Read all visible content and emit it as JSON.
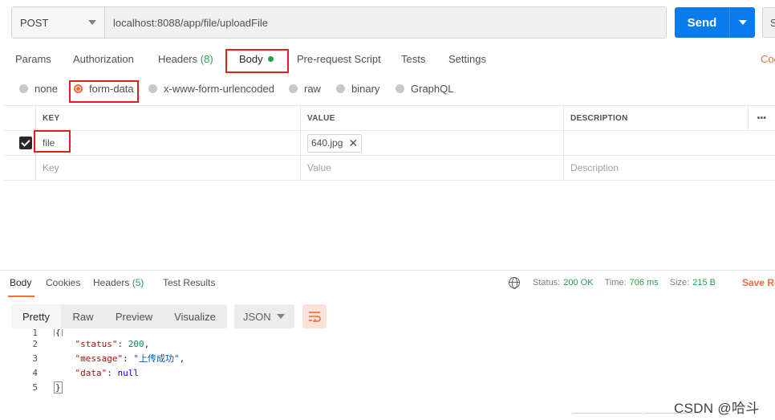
{
  "request": {
    "method": "POST",
    "url": "localhost:8088/app/file/uploadFile",
    "send_label": "Send",
    "save_label": "S"
  },
  "tabs": [
    {
      "label": "Params"
    },
    {
      "label": "Authorization"
    },
    {
      "label": "Headers",
      "count": "(8)"
    },
    {
      "label": "Body"
    },
    {
      "label": "Pre-request Script"
    },
    {
      "label": "Tests"
    },
    {
      "label": "Settings"
    }
  ],
  "cookies_link": "Coo",
  "body_types": [
    {
      "label": "none",
      "selected": false
    },
    {
      "label": "form-data",
      "selected": true
    },
    {
      "label": "x-www-form-urlencoded",
      "selected": false
    },
    {
      "label": "raw",
      "selected": false
    },
    {
      "label": "binary",
      "selected": false
    },
    {
      "label": "GraphQL",
      "selected": false
    }
  ],
  "table": {
    "headers": {
      "key": "KEY",
      "value": "VALUE",
      "description": "DESCRIPTION",
      "more": "•••"
    },
    "rows": [
      {
        "checked": true,
        "key": "file",
        "value": "640.jpg",
        "description": ""
      }
    ],
    "placeholders": {
      "key": "Key",
      "value": "Value",
      "description": "Description"
    }
  },
  "response": {
    "tabs": [
      {
        "label": "Body"
      },
      {
        "label": "Cookies"
      },
      {
        "label": "Headers",
        "count": "(5)"
      },
      {
        "label": "Test Results"
      }
    ],
    "status_label": "Status:",
    "status_value": "200 OK",
    "time_label": "Time:",
    "time_value": "706 ms",
    "size_label": "Size:",
    "size_value": "215 B",
    "save_label": "Save Re",
    "formats": [
      "Pretty",
      "Raw",
      "Preview",
      "Visualize"
    ],
    "format_selected": "Pretty",
    "language": "JSON",
    "code_lines": [
      {
        "n": "1",
        "text": "{"
      },
      {
        "n": "2",
        "key": "\"status\"",
        "value": "200",
        "type": "num",
        "trail": ","
      },
      {
        "n": "3",
        "key": "\"message\"",
        "value": "\"上传成功\"",
        "type": "str",
        "trail": ","
      },
      {
        "n": "4",
        "key": "\"data\"",
        "value": "null",
        "type": "kw",
        "trail": ""
      },
      {
        "n": "5",
        "text": "}"
      }
    ]
  },
  "watermark": "CSDN @哈斗",
  "colors": {
    "accent": "#f26b3a",
    "send": "#097bed",
    "success": "#26a04d",
    "highlight": "#e0201b"
  }
}
